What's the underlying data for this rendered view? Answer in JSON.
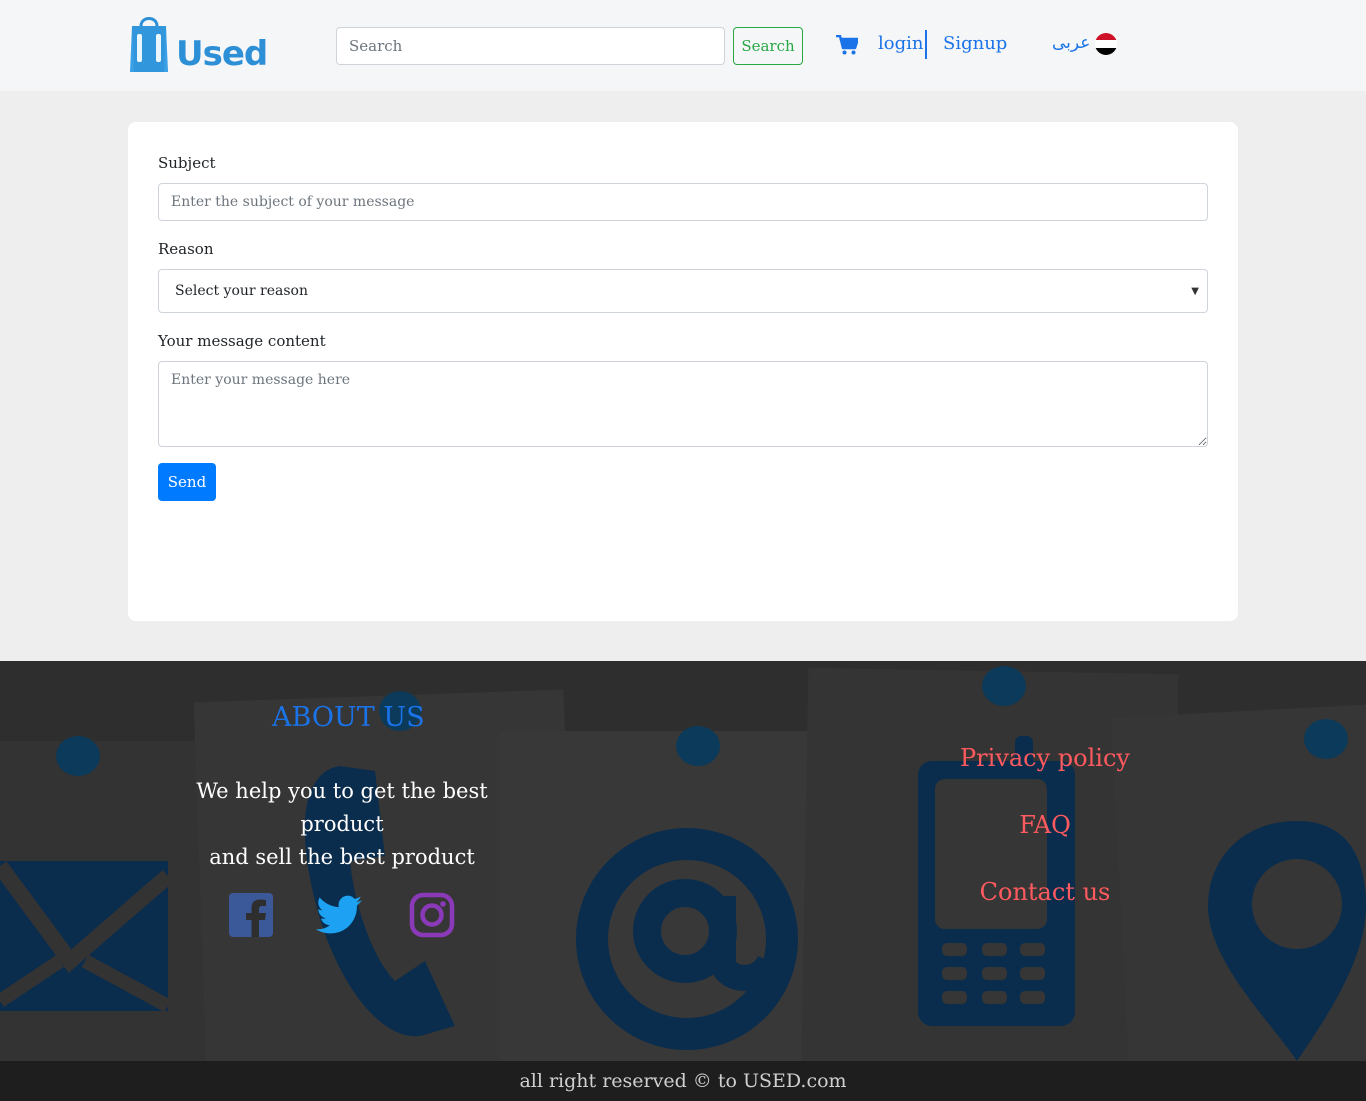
{
  "header": {
    "logo_text": "Used",
    "search_placeholder": "Search",
    "search_button": "Search",
    "login": "login",
    "signup": "Signup",
    "language": "عربى"
  },
  "form": {
    "subject_label": "Subject",
    "subject_placeholder": "Enter the subject of your message",
    "reason_label": "Reason",
    "reason_selected": "Select your reason",
    "message_label": "Your message content",
    "message_placeholder": "Enter your message here",
    "send_button": "Send"
  },
  "footer": {
    "about_title": "ABOUT US",
    "about_line1": "We help you to get the best product",
    "about_line2": "and sell the best product",
    "links": [
      "Privacy policy",
      "FAQ",
      "Contact us"
    ],
    "copyright": "all right reserved © to USED.com"
  },
  "colors": {
    "brand": "#2d8fd5",
    "link_blue": "#1a73e8",
    "button_primary": "#007bff",
    "search_green": "#28a745",
    "footer_links": "#ff5a5f",
    "footer_bg": "#2e2e2e",
    "icon_navy": "#0b2d4d"
  },
  "icons": [
    "bag-logo-icon",
    "cart-icon",
    "egypt-flag-icon",
    "facebook-icon",
    "twitter-icon",
    "instagram-icon"
  ]
}
